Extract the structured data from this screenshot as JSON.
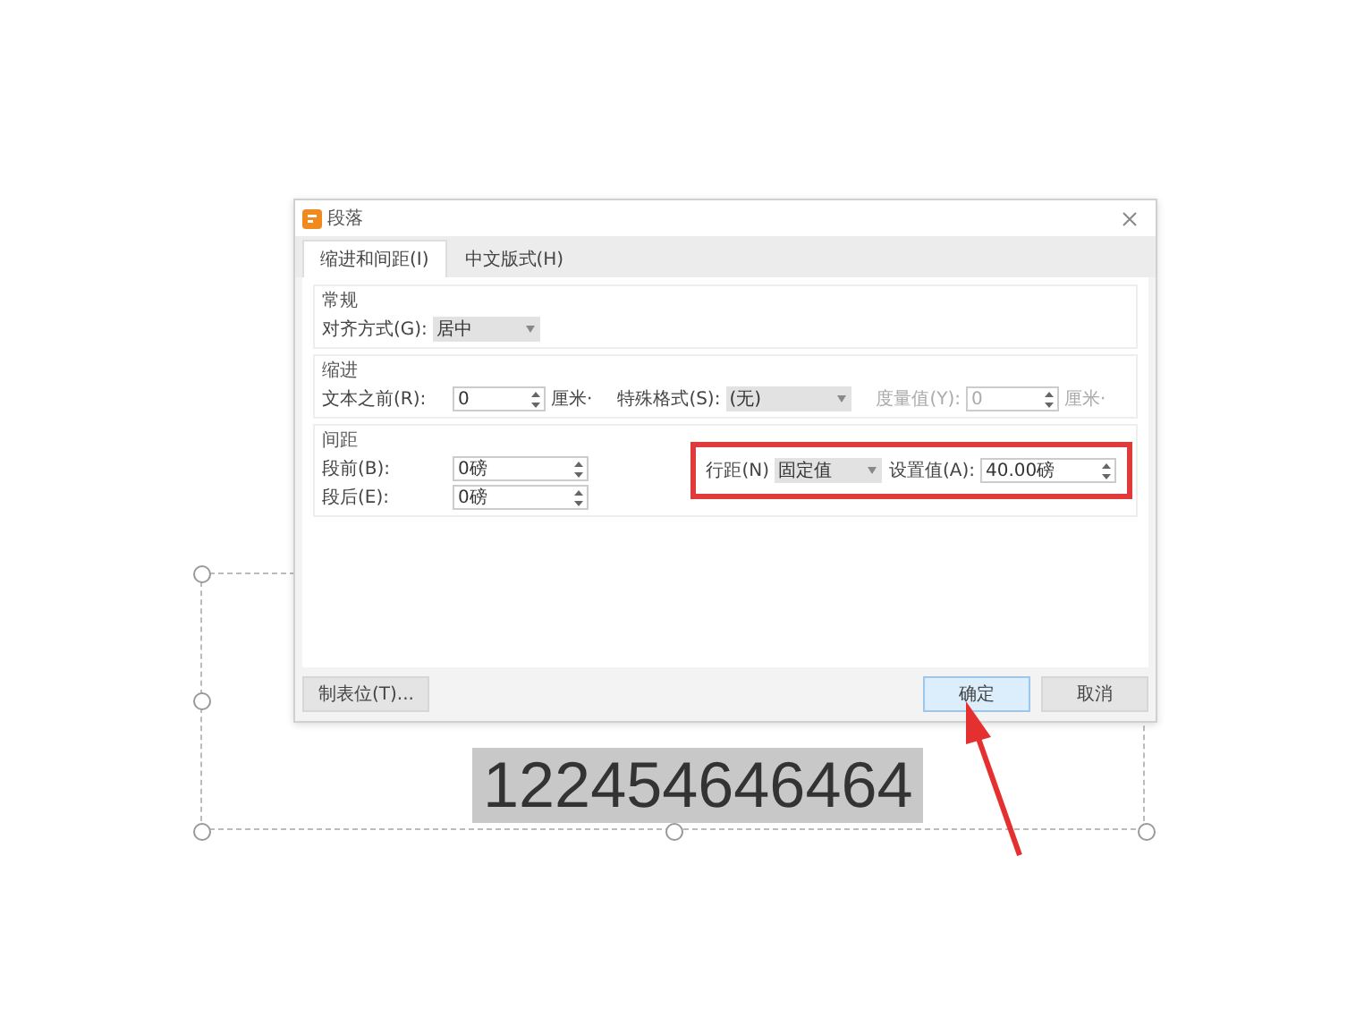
{
  "slide": {
    "text": "122454646464"
  },
  "dialog": {
    "title": "段落",
    "tabs": [
      {
        "label": "缩进和间距(I)",
        "selected": true
      },
      {
        "label": "中文版式(H)",
        "selected": false
      }
    ],
    "sections": [
      {
        "title": "常规",
        "rows": [
          [
            {
              "kind": "select",
              "label": "对齐方式(G):",
              "value": "居中",
              "disabled": false
            }
          ]
        ]
      },
      {
        "title": "缩进",
        "rows": [
          [
            {
              "kind": "spin",
              "label": "文本之前(R):",
              "value": "0",
              "unit": "厘米·",
              "disabled": false
            },
            {
              "kind": "select",
              "label": "特殊格式(S):",
              "value": "(无)",
              "disabled": false
            },
            {
              "kind": "spin",
              "label": "度量值(Y):",
              "value": "0",
              "unit": "厘米·",
              "disabled": true
            }
          ]
        ]
      },
      {
        "title": "间距",
        "rows": [
          [
            {
              "kind": "spin",
              "label": "段前(B):",
              "value": "0磅",
              "disabled": false
            }
          ],
          [
            {
              "kind": "spin",
              "label": "段后(E):",
              "value": "0磅",
              "disabled": false
            }
          ]
        ],
        "highlighted_fields": [
          {
            "kind": "select",
            "label": "行距(N)",
            "value": "固定值",
            "disabled": false
          },
          {
            "kind": "spin",
            "label": "设置值(A):",
            "value": "40.00磅",
            "disabled": false
          }
        ]
      }
    ],
    "buttons": [
      {
        "label": "制表位(T)...",
        "focused": false
      },
      {
        "label": "确定",
        "focused": true
      },
      {
        "label": "取消",
        "focused": false
      }
    ]
  }
}
